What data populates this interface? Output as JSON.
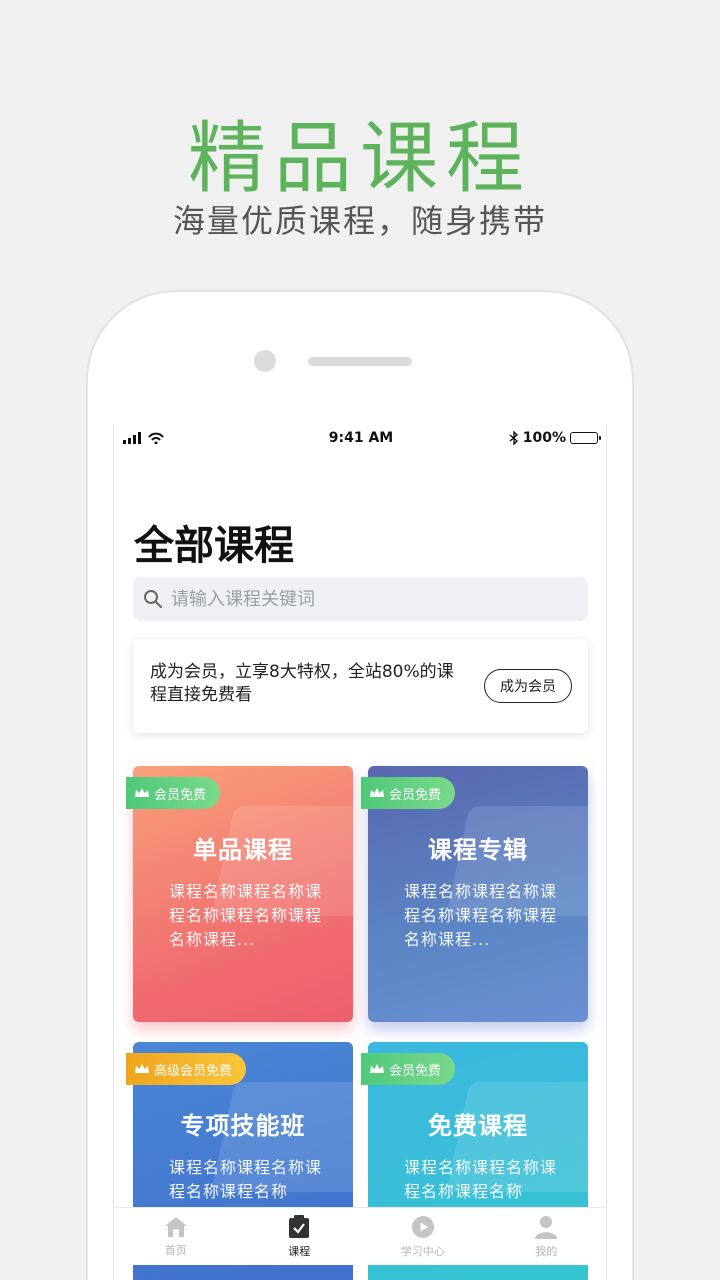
{
  "promo": {
    "title": "精品课程",
    "subtitle": "海量优质课程，随身携带"
  },
  "status_bar": {
    "time": "9:41 AM",
    "battery": "100%"
  },
  "page": {
    "title": "全部课程"
  },
  "search": {
    "placeholder": "请输入课程关键词"
  },
  "membership": {
    "text": "成为会员，立享8大特权，全站80%的课程直接免费看",
    "button": "成为会员"
  },
  "courses": [
    {
      "badge": "会员免费",
      "name": "单品课程",
      "desc": "课程名称课程名称课程名称课程名称课程名称课程..."
    },
    {
      "badge": "会员免费",
      "name": "课程专辑",
      "desc": "课程名称课程名称课程名称课程名称课程名称课程..."
    },
    {
      "badge": "高级会员免费",
      "name": "专项技能班",
      "desc": "课程名称课程名称课程名称课程名称"
    },
    {
      "badge": "会员免费",
      "name": "免费课程",
      "desc": "课程名称课程名称课程名称课程名称"
    }
  ],
  "tabbar": {
    "items": [
      {
        "label": "首页",
        "icon": "home-icon"
      },
      {
        "label": "课程",
        "icon": "clipboard-check-icon"
      },
      {
        "label": "学习中心",
        "icon": "play-bubble-icon"
      },
      {
        "label": "我的",
        "icon": "user-icon"
      }
    ],
    "active_index": 1
  },
  "colors": {
    "accent_green": "#5cb35b",
    "badge_green": "#4fc87a",
    "badge_gold": "#f0a41d"
  }
}
